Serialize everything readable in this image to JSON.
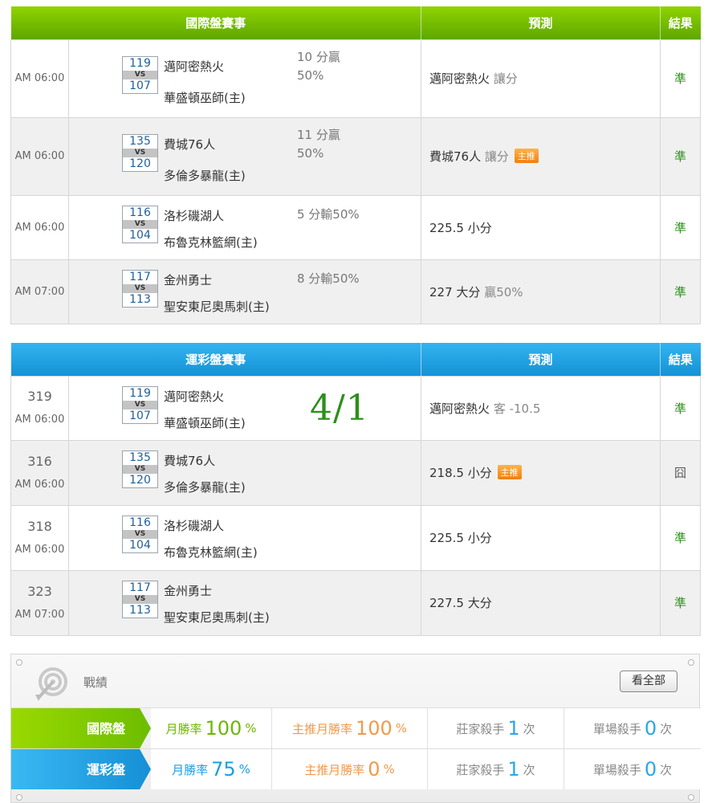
{
  "intl": {
    "headers": {
      "game": "國際盤賽事",
      "pred": "預測",
      "result": "結果"
    },
    "rows": [
      {
        "code": "",
        "time": "AM 06:00",
        "s1": "119",
        "s2": "107",
        "team1": "邁阿密熱火",
        "team2": "華盛頓巫師(主)",
        "odds1": "10 分贏",
        "odds2": "50%",
        "pick": "邁阿密熱火",
        "note": "讓分",
        "badge": "",
        "result": "準"
      },
      {
        "code": "",
        "time": "AM 06:00",
        "s1": "135",
        "s2": "120",
        "team1": "費城76人",
        "team2": "多倫多暴龍(主)",
        "odds1": "11 分贏",
        "odds2": "50%",
        "pick": "費城76人",
        "note": "讓分",
        "badge": "主推",
        "result": "準"
      },
      {
        "code": "",
        "time": "AM 06:00",
        "s1": "116",
        "s2": "104",
        "team1": "洛杉磯湖人",
        "team2": "布魯克林籃網(主)",
        "odds1": "5 分輸50%",
        "odds2": "",
        "pick": "225.5 小分",
        "note": "",
        "badge": "",
        "result": "準"
      },
      {
        "code": "",
        "time": "AM 07:00",
        "s1": "117",
        "s2": "113",
        "team1": "金州勇士",
        "team2": "聖安東尼奧馬刺(主)",
        "odds1": "8 分輸50%",
        "odds2": "",
        "pick": "227 大分",
        "note": "贏50%",
        "badge": "",
        "result": "準"
      }
    ]
  },
  "lottery": {
    "headers": {
      "game": "運彩盤賽事",
      "pred": "預測",
      "result": "結果"
    },
    "date": "4/1",
    "rows": [
      {
        "code": "319",
        "time": "AM 06:00",
        "s1": "119",
        "s2": "107",
        "team1": "邁阿密熱火",
        "team2": "華盛頓巫師(主)",
        "odds1": "",
        "odds2": "",
        "pick": "邁阿密熱火",
        "note": "客 -10.5",
        "badge": "",
        "result": "準"
      },
      {
        "code": "316",
        "time": "AM 06:00",
        "s1": "135",
        "s2": "120",
        "team1": "費城76人",
        "team2": "多倫多暴龍(主)",
        "odds1": "",
        "odds2": "",
        "pick": "218.5 小分",
        "note": "",
        "badge": "主推",
        "result": "囧"
      },
      {
        "code": "318",
        "time": "AM 06:00",
        "s1": "116",
        "s2": "104",
        "team1": "洛杉磯湖人",
        "team2": "布魯克林籃網(主)",
        "odds1": "",
        "odds2": "",
        "pick": "225.5 小分",
        "note": "",
        "badge": "",
        "result": "準"
      },
      {
        "code": "323",
        "time": "AM 07:00",
        "s1": "117",
        "s2": "113",
        "team1": "金州勇士",
        "team2": "聖安東尼奧馬刺(主)",
        "odds1": "",
        "odds2": "",
        "pick": "227.5 大分",
        "note": "",
        "badge": "",
        "result": "準"
      }
    ]
  },
  "record": {
    "title": "戰績",
    "view_all": "看全部",
    "rows": [
      {
        "label": "國際盤",
        "win_rate_label": "月勝率",
        "win_rate": "100",
        "pct1": "%",
        "main_rate_label": "主推月勝率",
        "main_rate": "100",
        "pct2": "%",
        "dealer_label": "莊家殺手",
        "dealer": "1",
        "times1": "次",
        "single_label": "單場殺手",
        "single": "0",
        "times2": "次"
      },
      {
        "label": "運彩盤",
        "win_rate_label": "月勝率",
        "win_rate": "75",
        "pct1": "%",
        "main_rate_label": "主推月勝率",
        "main_rate": "0",
        "pct2": "%",
        "dealer_label": "莊家殺手",
        "dealer": "1",
        "times1": "次",
        "single_label": "單場殺手",
        "single": "0",
        "times2": "次"
      }
    ]
  },
  "colors": {
    "green_header": "#6cbd00",
    "blue_header": "#1a9be0",
    "hit": "#2c8f1b",
    "badge": "#f07f12"
  },
  "icons": {
    "target": "target-arrow-icon"
  }
}
